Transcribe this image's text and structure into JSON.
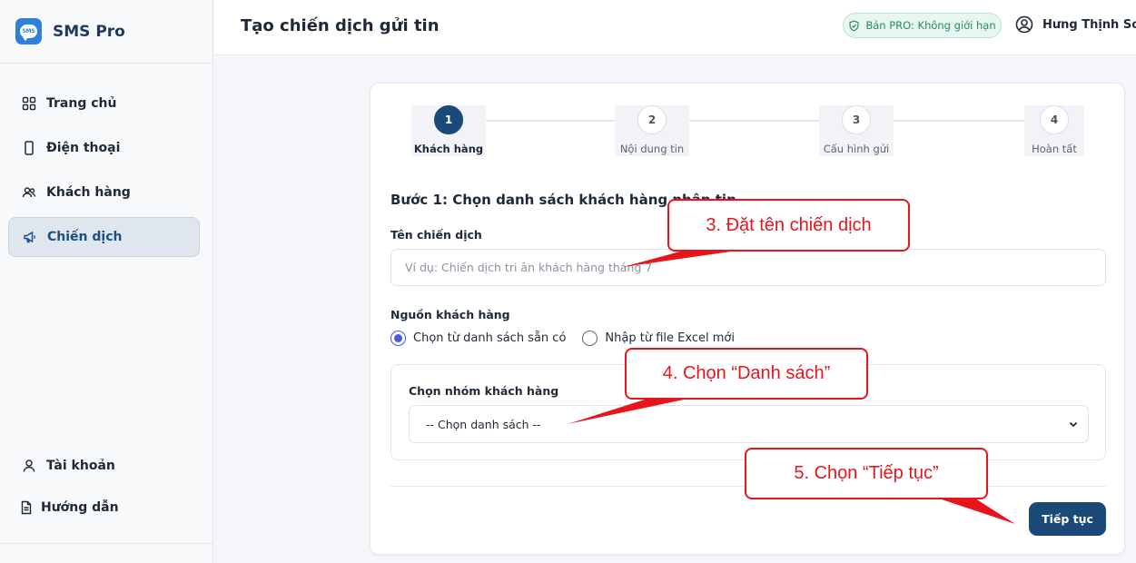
{
  "app": {
    "name": "SMS Pro",
    "logo_text": "SMS"
  },
  "sidebar": {
    "items": [
      {
        "label": "Trang chủ",
        "icon": "grid-icon"
      },
      {
        "label": "Điện thoại",
        "icon": "phone-icon"
      },
      {
        "label": "Khách hàng",
        "icon": "users-icon"
      },
      {
        "label": "Chiến dịch",
        "icon": "megaphone-icon",
        "active": true
      }
    ],
    "bottom_items": [
      {
        "label": "Tài khoản",
        "icon": "user-icon"
      },
      {
        "label": "Hướng dẫn",
        "icon": "document-icon"
      }
    ]
  },
  "header": {
    "title": "Tạo chiến dịch gửi tin",
    "pro_badge": "Bản PRO: Không giới hạn",
    "user_name": "Hưng Thịnh Soft |"
  },
  "stepper": {
    "steps": [
      {
        "number": "1",
        "label": "Khách hàng",
        "active": true
      },
      {
        "number": "2",
        "label": "Nội dung tin"
      },
      {
        "number": "3",
        "label": "Cấu hình gửi"
      },
      {
        "number": "4",
        "label": "Hoàn tất"
      }
    ]
  },
  "form": {
    "section_title": "Bước 1: Chọn danh sách khách hàng nhận tin",
    "campaign_name_label": "Tên chiến dịch",
    "campaign_name_placeholder": "Ví dụ: Chiến dịch tri ân khách hàng tháng 7",
    "campaign_name_value": "",
    "source_label": "Nguồn khách hàng",
    "source_options": [
      {
        "label": "Chọn từ danh sách sẵn có",
        "checked": true
      },
      {
        "label": "Nhập từ file Excel mới",
        "checked": false
      }
    ],
    "group_label": "Chọn nhóm khách hàng",
    "group_select_value": "-- Chọn danh sách --",
    "next_button": "Tiếp tục"
  },
  "annotations": {
    "step3": "3. Đặt tên chiến dịch",
    "step4": "4. Chọn “Danh sách”",
    "step5": "5. Chọn “Tiếp tục”"
  },
  "colors": {
    "primary": "#1b4a78",
    "annotation": "#e8141b",
    "pro_badge": "#2e8b5c",
    "radio_accent": "#4a5bd6"
  }
}
